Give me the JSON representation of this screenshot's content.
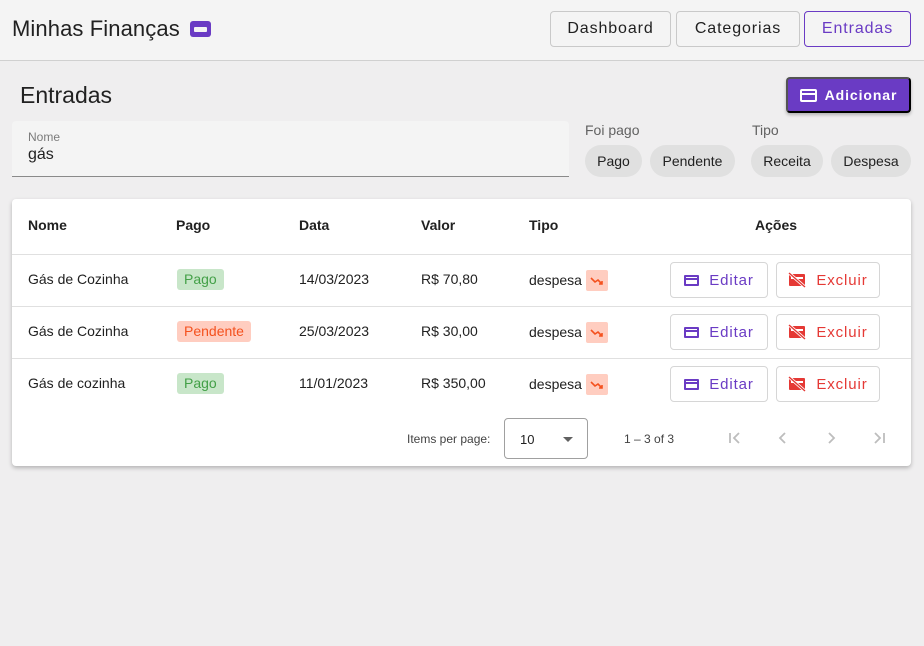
{
  "app": {
    "title": "Minhas Finanças",
    "logo_icon": "wallet-icon",
    "accent": "#6a3bc4"
  },
  "nav": {
    "dashboard": "Dashboard",
    "categorias": "Categorias",
    "entradas": "Entradas",
    "active": "Entradas"
  },
  "page": {
    "title": "Entradas",
    "add_label": "Adicionar",
    "add_icon": "add-card-icon"
  },
  "filters": {
    "name": {
      "label": "Nome",
      "value": "gás"
    },
    "pago": {
      "label": "Foi pago",
      "options": [
        "Pago",
        "Pendente"
      ]
    },
    "tipo": {
      "label": "Tipo",
      "options": [
        "Receita",
        "Despesa"
      ]
    }
  },
  "table": {
    "headers": {
      "nome": "Nome",
      "pago": "Pago",
      "data": "Data",
      "valor": "Valor",
      "tipo": "Tipo",
      "acoes": "Ações"
    },
    "rows": [
      {
        "nome": "Gás de Cozinha",
        "pago": "Pago",
        "status": "pago",
        "data": "14/03/2023",
        "valor": "R$ 70,80",
        "tipo": "despesa",
        "editar": "Editar",
        "excluir": "Excluir"
      },
      {
        "nome": "Gás de Cozinha",
        "pago": "Pendente",
        "status": "pendente",
        "data": "25/03/2023",
        "valor": "R$ 30,00",
        "tipo": "despesa",
        "editar": "Editar",
        "excluir": "Excluir"
      },
      {
        "nome": "Gás de cozinha",
        "pago": "Pago",
        "status": "pago",
        "data": "11/01/2023",
        "valor": "R$ 350,00",
        "tipo": "despesa",
        "editar": "Editar",
        "excluir": "Excluir"
      }
    ]
  },
  "pager": {
    "items_per_page_label": "Items per page:",
    "page_size": "10",
    "range": "1 – 3 of 3"
  },
  "colors": {
    "pago_bg": "#c8e6c9",
    "pago_fg": "#43a047",
    "pendente_bg": "#ffcdc0",
    "pendente_fg": "#f4511e",
    "delete": "#e53935"
  }
}
